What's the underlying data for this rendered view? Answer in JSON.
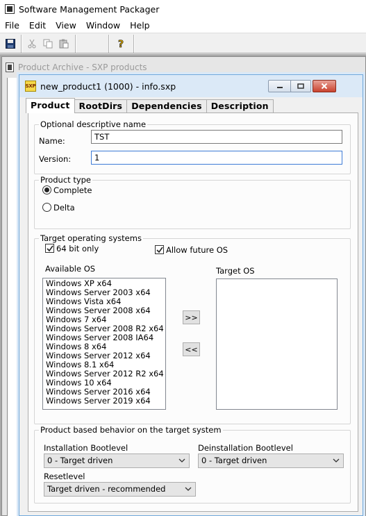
{
  "app": {
    "title": "Software Management Packager",
    "menu": [
      "File",
      "Edit",
      "View",
      "Window",
      "Help"
    ]
  },
  "toolbar": {
    "icons": [
      "save-icon",
      "cut-icon",
      "copy-icon",
      "paste-icon",
      "help-icon"
    ]
  },
  "archive_window": {
    "title": "Product Archive - SXP products"
  },
  "child_window": {
    "icon_text": "SXP",
    "title": "new_product1 (1000) - info.sxp",
    "tabs": [
      "Product",
      "RootDirs",
      "Dependencies",
      "Description"
    ],
    "active_tab": "Product"
  },
  "descriptive": {
    "legend": "Optional descriptive name",
    "name_label": "Name:",
    "name_value": "TST",
    "version_label": "Version:",
    "version_value": "1"
  },
  "product_type": {
    "legend": "Product type",
    "options": [
      "Complete",
      "Delta"
    ],
    "selected": "Complete"
  },
  "target_os": {
    "legend": "Target operating systems",
    "bit64_label": "64 bit only",
    "bit64_checked": true,
    "future_label": "Allow future OS",
    "future_checked": true,
    "available_label": "Available OS",
    "available": [
      "Windows XP x64",
      "Windows Server 2003 x64",
      "Windows Vista x64",
      "Windows Server 2008 x64",
      "Windows 7 x64",
      "Windows Server 2008 R2 x64",
      "Windows Server 2008 IA64",
      "Windows 8 x64",
      "Windows Server 2012 x64",
      "Windows 8.1 x64",
      "Windows Server 2012 R2 x64",
      "Windows 10 x64",
      "Windows Server 2016 x64",
      "Windows Server 2019 x64"
    ],
    "target_label": "Target OS",
    "target": [],
    "add_label": ">>",
    "remove_label": "<<"
  },
  "behavior": {
    "legend": "Product based  behavior on the target system",
    "install_label": "Installation Bootlevel",
    "install_value": "0 - Target driven",
    "deinstall_label": "Deinstallation Bootlevel",
    "deinstall_value": "0 - Target driven",
    "reset_label": "Resetlevel",
    "reset_value": "Target driven - recommended"
  },
  "colors": {
    "focus_border": "#3d7bd6",
    "child_title_bg": "#dbe9f7",
    "close_button": "#c9432f"
  }
}
